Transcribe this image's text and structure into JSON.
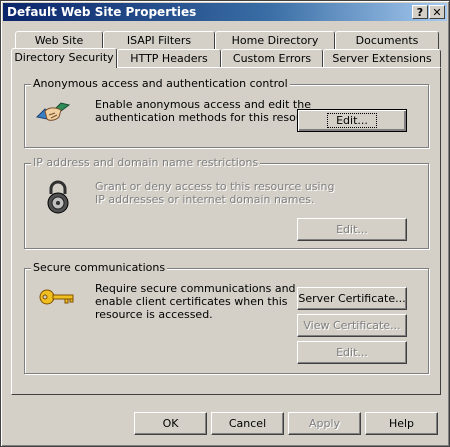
{
  "window": {
    "title": "Default Web Site Properties",
    "help_btn": "?",
    "close_btn": "✕"
  },
  "tabs_back": [
    "Web Site",
    "ISAPI Filters",
    "Home Directory",
    "Documents"
  ],
  "tabs_front": [
    "Directory Security",
    "HTTP Headers",
    "Custom Errors",
    "Server Extensions"
  ],
  "anon": {
    "label": "Anonymous access and authentication control",
    "desc_line1": "Enable anonymous access and edit the",
    "desc_line2": "authentication methods for this resource.",
    "edit_button": "Edit..."
  },
  "ip": {
    "label": "IP address and domain name restrictions",
    "desc_line1": "Grant or deny access to this resource using",
    "desc_line2": "IP addresses or internet domain names.",
    "edit_button": "Edit..."
  },
  "secure": {
    "label": "Secure communications",
    "desc_line1": "Require secure communications and",
    "desc_line2": "enable client certificates when this",
    "desc_line3": "resource is accessed.",
    "server_cert_button": "Server Certificate...",
    "view_cert_button": "View Certificate...",
    "edit_button": "Edit..."
  },
  "footer": {
    "ok": "OK",
    "cancel": "Cancel",
    "apply": "Apply",
    "help": "Help"
  },
  "icons": {
    "anon": "handshake-icon",
    "ip": "padlock-icon",
    "secure": "key-icon"
  }
}
